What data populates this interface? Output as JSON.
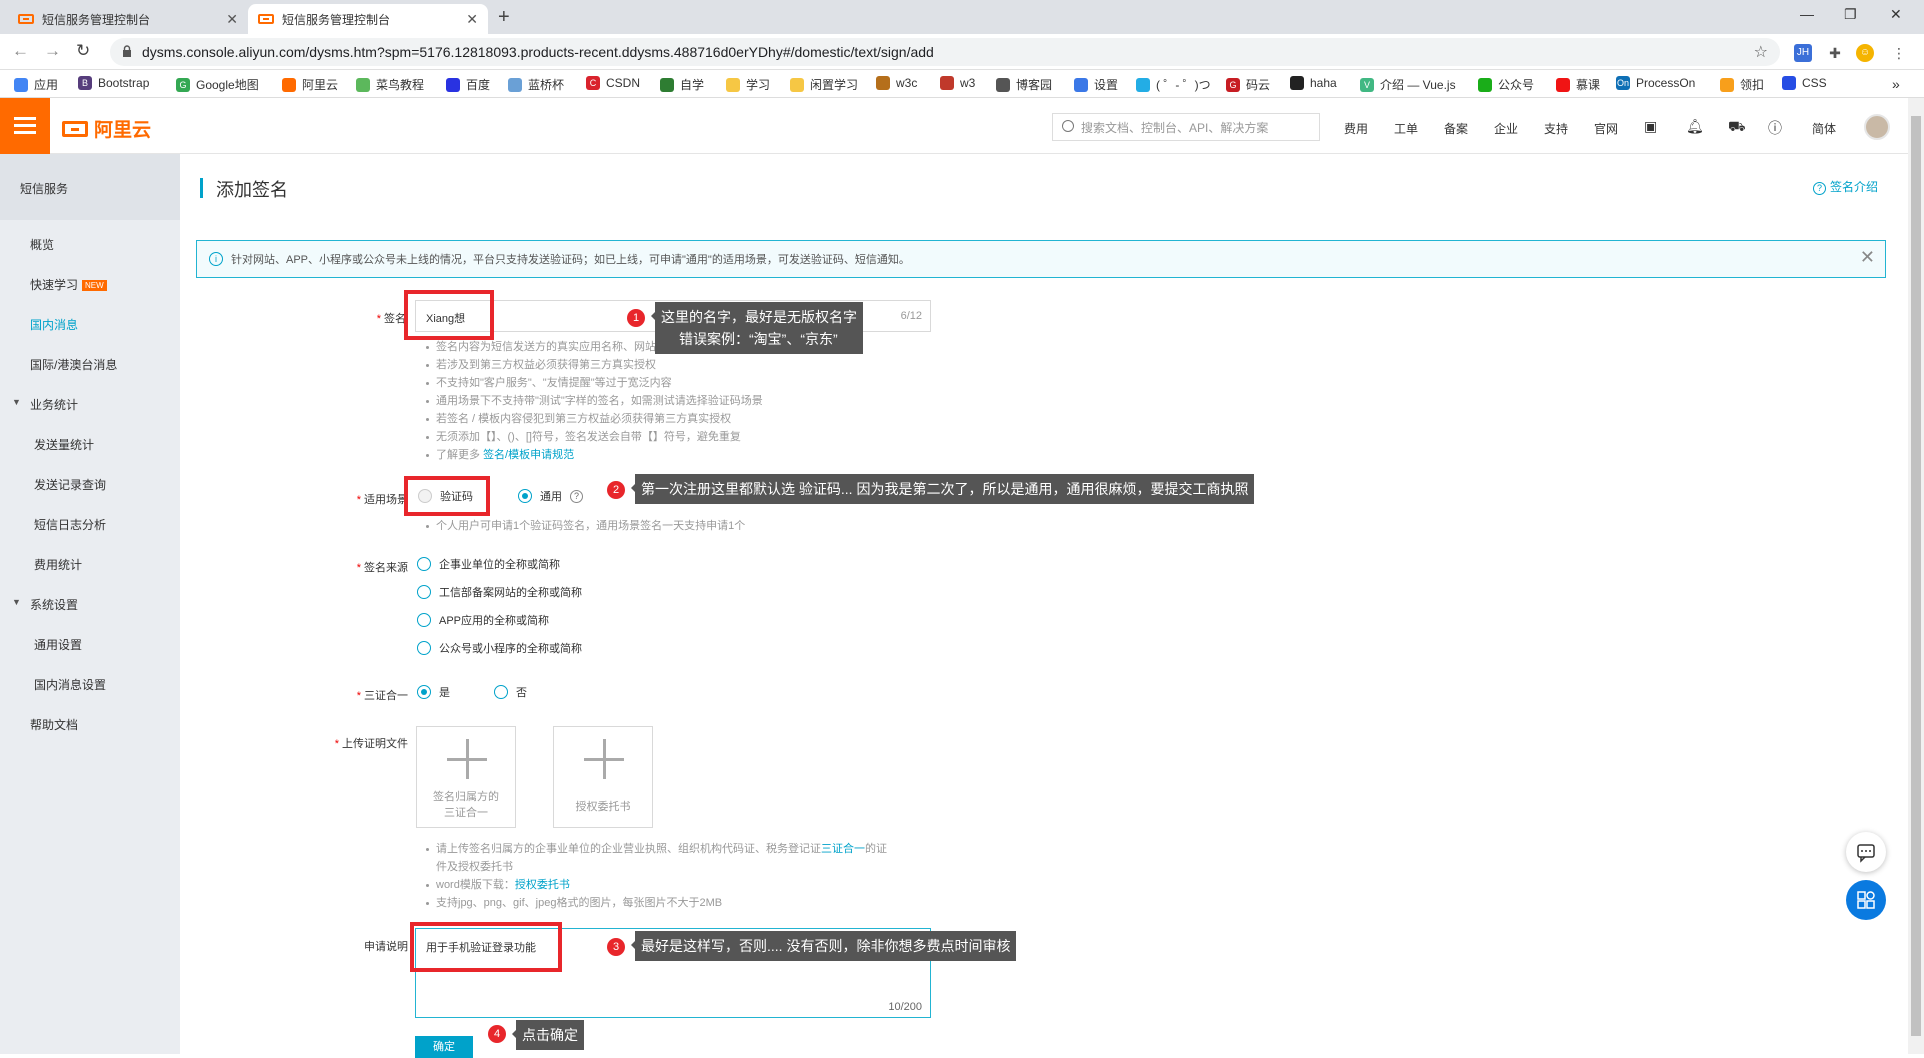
{
  "browser": {
    "tabs": [
      {
        "title": "短信服务管理控制台",
        "active": false
      },
      {
        "title": "短信服务管理控制台",
        "active": true
      }
    ],
    "url": "dysms.console.aliyun.com/dysms.htm?spm=5176.12818093.products-recent.ddysms.488716d0erYDhy#/domestic/text/sign/add",
    "extensions": [
      "JH"
    ],
    "bookmarks": [
      "应用",
      "Bootstrap",
      "Google地图",
      "阿里云",
      "菜鸟教程",
      "百度",
      "蓝桥杯",
      "CSDN",
      "自学",
      "学习",
      "闲置学习",
      "w3c",
      "w3",
      "博客园",
      "设置",
      "( ゜- ゜)つ",
      "码云",
      "haha",
      "介绍 — Vue.js",
      "公众号",
      "慕课",
      "ProcessOn",
      "领扣",
      "CSS"
    ]
  },
  "console": {
    "logo": "阿里云",
    "search_placeholder": "搜索文档、控制台、API、解决方案",
    "nav": [
      "费用",
      "工单",
      "备案",
      "企业",
      "支持",
      "官网"
    ],
    "lang": "简体"
  },
  "sidebar": {
    "title": "短信服务",
    "items": [
      {
        "label": "概览"
      },
      {
        "label": "快速学习",
        "badge": "NEW"
      },
      {
        "label": "国内消息"
      },
      {
        "label": "国际/港澳台消息"
      },
      {
        "label": "业务统计",
        "group": true
      },
      {
        "label": "发送量统计"
      },
      {
        "label": "发送记录查询"
      },
      {
        "label": "短信日志分析"
      },
      {
        "label": "费用统计"
      },
      {
        "label": "系统设置",
        "group": true
      },
      {
        "label": "通用设置"
      },
      {
        "label": "国内消息设置"
      },
      {
        "label": "帮助文档"
      }
    ]
  },
  "page": {
    "title": "添加签名",
    "intro_link": "签名介绍",
    "notice": "针对网站、APP、小程序或公众号未上线的情况，平台只支持发送验证码；如已上线，可申请\"通用\"的适用场景，可发送验证码、短信通知。"
  },
  "form": {
    "sign_label": "签名",
    "sign_value": "Xiang想",
    "sign_count": "6/12",
    "sign_hints": [
      "签名内容为短信发送方的真实应用名称、网站名称、公司名称等",
      "若涉及到第三方权益必须获得第三方真实授权",
      "不支持如\"客户服务\"、\"友情提醒\"等过于宽泛内容",
      "通用场景下不支持带\"测试\"字样的签名，如需测试请选择验证码场景",
      "若签名 / 模板内容侵犯到第三方权益必须获得第三方真实授权",
      "无须添加【】、()、[]符号，签名发送会自带【】符号，避免重复"
    ],
    "learn_more_prefix": "了解更多 ",
    "learn_more_link": "签名/模板申请规范",
    "scene_label": "适用场景",
    "scene_options": [
      "验证码",
      "通用"
    ],
    "scene_hint": "个人用户可申请1个验证码签名，通用场景签名一天支持申请1个",
    "source_label": "签名来源",
    "source_options": [
      "企事业单位的全称或简称",
      "工信部备案网站的全称或简称",
      "APP应用的全称或简称",
      "公众号或小程序的全称或简称"
    ],
    "three_label": "三证合一",
    "three_options": [
      "是",
      "否"
    ],
    "upload_label": "上传证明文件",
    "upload_box1": [
      "签名归属方的",
      "三证合一"
    ],
    "upload_box2": "授权委托书",
    "upload_hint1_prefix": "请上传签名归属方的企事业单位的企业营业执照、组织机构代码证、税务登记证",
    "upload_hint1_link": "三证合一",
    "upload_hint1_suffix": "的证",
    "upload_hint1_line2": "件及授权委托书",
    "upload_hint2_prefix": "word模版下载：",
    "upload_hint2_link": "授权委托书",
    "upload_hint3": "支持jpg、png、gif、jpeg格式的图片，每张图片不大于2MB",
    "desc_label": "申请说明",
    "desc_value": "用于手机验证登录功能",
    "desc_count": "10/200",
    "confirm": "确定"
  },
  "annotations": [
    {
      "num": "1",
      "lines": [
        "这里的名字，最好是无版权名字",
        "错误案例：“淘宝”、“京东”"
      ]
    },
    {
      "num": "2",
      "lines": [
        "第一次注册这里都默认选 验证码... 因为我是第二次了，所以是通用，通用很麻烦，要提交工商执照"
      ]
    },
    {
      "num": "3",
      "lines": [
        "最好是这样写，否则.... 没有否则，除非你想多费点时间审核"
      ]
    },
    {
      "num": "4",
      "lines": [
        "点击确定"
      ]
    }
  ],
  "colors": {
    "accent": "#ff6a00",
    "primary": "#00a2ca",
    "annotation": "#e8262b"
  }
}
